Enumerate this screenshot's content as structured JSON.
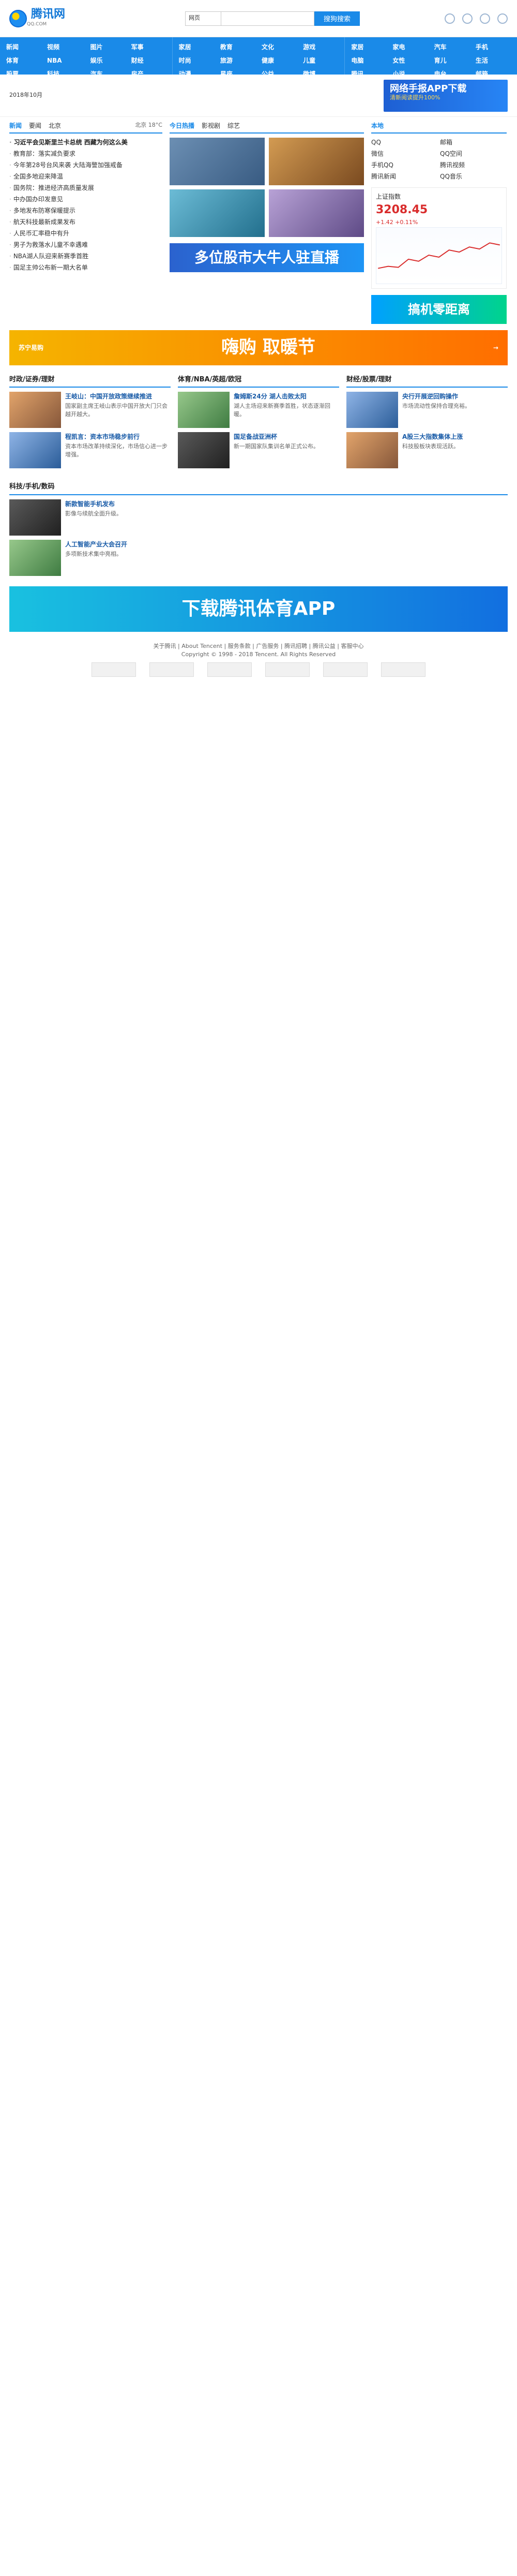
{
  "header": {
    "logo_text": "腾讯网",
    "logo_sub": "QQ.COM",
    "search_select": "网页",
    "search_placeholder": "",
    "search_button": "搜狗搜索"
  },
  "nav": [
    [
      "新闻",
      "视频",
      "图片",
      "军事",
      "体育",
      "NBA",
      "娱乐",
      "财经",
      "股票",
      "科技",
      "汽车",
      "房产"
    ],
    [
      "家居",
      "教育",
      "文化",
      "游戏",
      "时尚",
      "旅游",
      "健康",
      "儿童",
      "动漫",
      "星座",
      "公益",
      "微博"
    ],
    [
      "家居",
      "家电",
      "汽车",
      "手机",
      "电脑",
      "女性",
      "育儿",
      "生活",
      "腾讯",
      "小说",
      "电台",
      "邮箱"
    ]
  ],
  "topbar": {
    "date": "2018年10月",
    "app_title": "网络手报APP下载",
    "app_sub": "清新阅读提升100%"
  },
  "main": {
    "tabs": [
      "新闻",
      "要闻",
      "北京"
    ],
    "weather": "北京 18°C",
    "news": [
      "习近平会见斯里兰卡总统 西藏为何这么美",
      "教育部：落实减负要求",
      "今年第28号台风来袭 大陆海警加强戒备",
      "全国多地迎来降温",
      "国务院：推进经济高质量发展",
      "中办国办印发意见",
      "多地发布防寒保暖提示",
      "航天科技最新成果发布",
      "人民币汇率稳中有升",
      "男子为救落水儿童不幸遇难",
      "NBA湖人队迎来新赛季首胜",
      "国足主帅公布新一期大名单"
    ],
    "mid_title": "今日热播",
    "mid_tabs": [
      "今日热播",
      "影视剧",
      "综艺"
    ],
    "right_title": "本地",
    "right_list": [
      "QQ",
      "邮箱",
      "微信",
      "QQ空间",
      "手机QQ",
      "腾讯视频",
      "腾讯新闻",
      "QQ音乐"
    ],
    "stock_title": "上证指数",
    "stock_value": "3208.45",
    "stock_change": "+1.42 +0.11%"
  },
  "sections": [
    {
      "name": "时政/证券/理财",
      "items": [
        {
          "title": "王岐山：中国开放政策继续推进",
          "desc": "国家副主席王岐山表示中国开放大门只会越开越大。"
        },
        {
          "title": "程凯言：资本市场稳步前行",
          "desc": "资本市场改革持续深化，市场信心进一步增强。"
        }
      ]
    },
    {
      "name": "体育/NBA/英超/欧冠",
      "items": [
        {
          "title": "詹姆斯24分 湖人击败太阳",
          "desc": "湖人主场迎来新赛季首胜，状态逐渐回暖。"
        },
        {
          "title": "国足备战亚洲杯",
          "desc": "新一期国家队集训名单正式公布。"
        }
      ]
    },
    {
      "name": "财经/股票/理财",
      "items": [
        {
          "title": "央行开展逆回购操作",
          "desc": "市场流动性保持合理充裕。"
        },
        {
          "title": "A股三大指数集体上涨",
          "desc": "科技股板块表现活跃。"
        }
      ]
    },
    {
      "name": "科技/手机/数码",
      "items": [
        {
          "title": "新款智能手机发布",
          "desc": "影像与续航全面升级。"
        },
        {
          "title": "人工智能产业大会召开",
          "desc": "多项新技术集中亮相。"
        }
      ]
    }
  ],
  "ads": {
    "banner": "嗨购 取暖节",
    "banner_tag": "苏宁易购",
    "mid": "多位股市大牛人驻直播",
    "right": "搞机零距离",
    "bottom": "下载腾讯体育APP"
  },
  "footer": {
    "copyright": "Copyright © 1998 - 2018 Tencent. All Rights Reserved",
    "links": "关于腾讯 | About Tencent | 服务条款 | 广告服务 | 腾讯招聘 | 腾讯公益 | 客服中心"
  }
}
